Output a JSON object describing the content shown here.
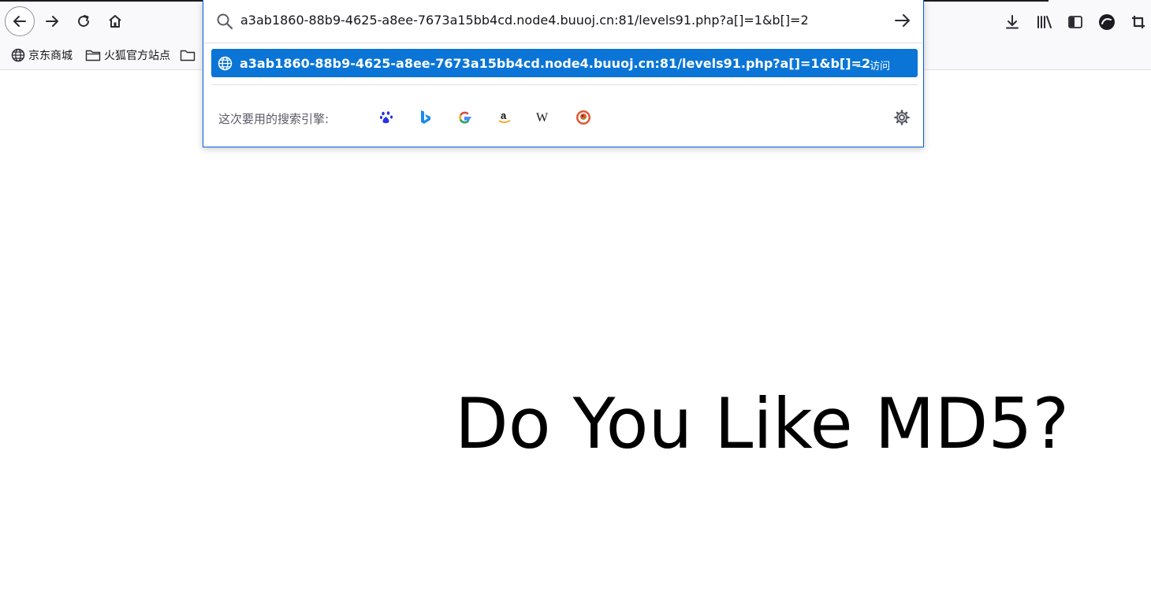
{
  "toolbar": {
    "back_icon": "back-arrow-icon",
    "forward_icon": "forward-arrow-icon",
    "reload_icon": "reload-icon",
    "home_icon": "home-icon"
  },
  "bookmarks": [
    {
      "label": "京东商城",
      "icon": "globe-icon"
    },
    {
      "label": "火狐官方站点",
      "icon": "folder-icon"
    }
  ],
  "urlbar": {
    "value": "a3ab1860-88b9-4625-a8ee-7673a15bb4cd.node4.buuoj.cn:81/levels91.php?a[]=1&b[]=2",
    "search_icon": "search-icon",
    "go_icon": "go-arrow-icon"
  },
  "suggestion": {
    "url": "a3ab1860-88b9-4625-a8ee-7673a15bb4cd.node4.buuoj.cn:81/levels91.php?a[]=1&b[]=2",
    "action": "— 访问",
    "icon": "globe-icon"
  },
  "search_engines": {
    "label": "这次要用的搜索引擎:",
    "engines": [
      {
        "name": "baidu-icon"
      },
      {
        "name": "bing-icon"
      },
      {
        "name": "google-icon"
      },
      {
        "name": "amazon-icon"
      },
      {
        "name": "wikipedia-icon"
      },
      {
        "name": "duckduckgo-icon"
      }
    ],
    "settings_icon": "gear-icon"
  },
  "right_toolbar": [
    "download-icon",
    "library-icon",
    "sidebar-icon",
    "account-icon",
    "screenshot-icon"
  ],
  "colors": {
    "accent": "#0a75d6",
    "focus_border": "#0060df",
    "page_text": "#000000"
  },
  "page": {
    "heading": "Do You Like MD5?"
  }
}
